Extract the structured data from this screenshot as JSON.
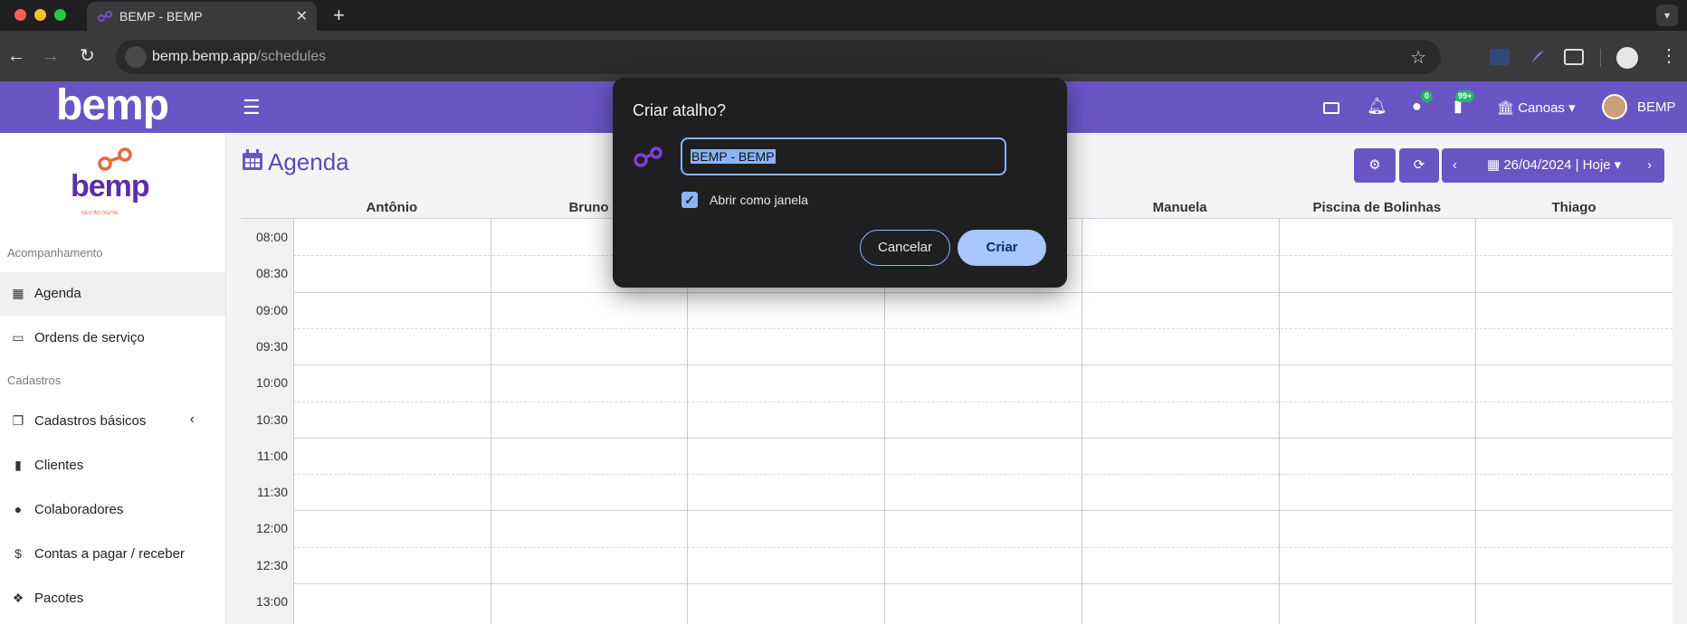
{
  "browser": {
    "tab_title": "BEMP - BEMP",
    "tab_close": "✕",
    "new_tab": "+",
    "url_host": "bemp.bemp.app",
    "url_path": "/schedules",
    "menu_icon": "chevron-down-icon"
  },
  "header": {
    "logo": "bemp",
    "badges": {
      "users": "0",
      "bookmarks": "99+"
    },
    "unit": "Canoas ▾",
    "username": "BEMP"
  },
  "sidebar": {
    "brand_word": "bemp",
    "brand_tag": "GESTÃO DIGITAL",
    "sections": {
      "acompanhamento": "Acompanhamento",
      "cadastros": "Cadastros"
    },
    "items": [
      {
        "label": "Agenda",
        "icon": "calendar-icon",
        "active": true
      },
      {
        "label": "Ordens de serviço",
        "icon": "ticket-icon"
      },
      {
        "label": "Cadastros básicos",
        "icon": "copy-icon"
      },
      {
        "label": "Clientes",
        "icon": "bookmark-icon"
      },
      {
        "label": "Colaboradores",
        "icon": "user-icon"
      },
      {
        "label": "Contas a pagar / receber",
        "icon": "invoice-icon"
      },
      {
        "label": "Pacotes",
        "icon": "dropbox-icon"
      }
    ]
  },
  "main": {
    "title": "Agenda",
    "date_label": "26/04/2024 | Hoje ▾",
    "columns": [
      "Antônio",
      "Bruno",
      "",
      "",
      "Manuela",
      "Piscina de Bolinhas",
      "Thiago"
    ],
    "times": [
      "08:00",
      "08:30",
      "09:00",
      "09:30",
      "10:00",
      "10:30",
      "11:00",
      "11:30",
      "12:00",
      "12:30",
      "13:00"
    ]
  },
  "dialog": {
    "title": "Criar atalho?",
    "name_value": "BEMP - BEMP",
    "open_as_window_label": "Abrir como janela",
    "open_as_window_checked": true,
    "cancel_label": "Cancelar",
    "create_label": "Criar"
  },
  "colors": {
    "brand_purple": "#6a55c4",
    "brand_orange": "#e5673a",
    "dialog_accent": "#8ab4f8"
  }
}
